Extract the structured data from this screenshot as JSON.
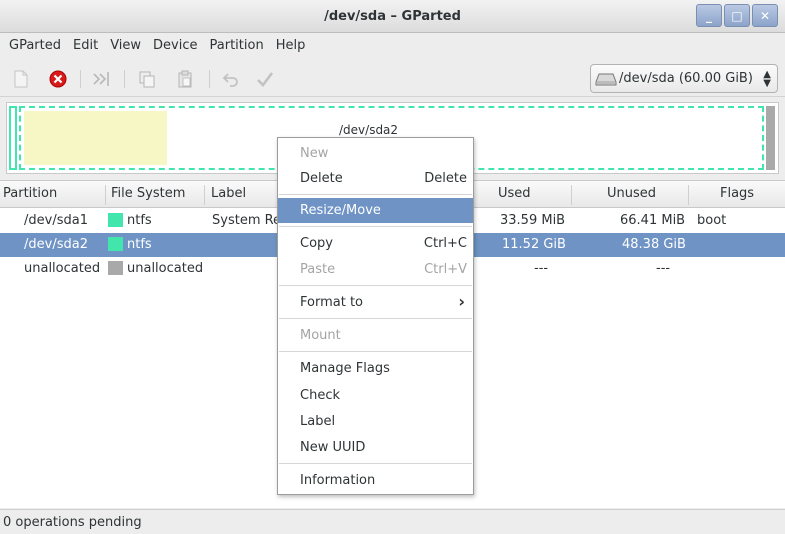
{
  "window": {
    "title": "/dev/sda – GParted",
    "controls": [
      "_",
      "□",
      "✕"
    ]
  },
  "menubar": [
    "GParted",
    "Edit",
    "View",
    "Device",
    "Partition",
    "Help"
  ],
  "toolbar": {
    "icons": [
      "new-icon",
      "delete-icon",
      "resize-move-icon",
      "copy-icon",
      "paste-icon",
      "undo-icon",
      "apply-icon"
    ],
    "device_selector": "/dev/sda  (60.00 GiB)"
  },
  "visual": {
    "selected_partition_label": "/dev/sda2"
  },
  "table": {
    "headers": [
      "Partition",
      "File System",
      "Label",
      "Used",
      "Unused",
      "Flags"
    ],
    "rows": [
      {
        "partition": "/dev/sda1",
        "filesystem": "ntfs",
        "label": "System Re",
        "used": "33.59 MiB",
        "unused": "66.41 MiB",
        "flags": "boot",
        "color": "#42e5ac"
      },
      {
        "partition": "/dev/sda2",
        "filesystem": "ntfs",
        "label": "",
        "used": "11.52 GiB",
        "unused": "48.38 GiB",
        "flags": "",
        "color": "#42e5ac"
      },
      {
        "partition": "unallocated",
        "filesystem": "unallocated",
        "label": "",
        "used": "---",
        "unused": "---",
        "flags": "",
        "color": "#a9a9a9"
      }
    ]
  },
  "context_menu": {
    "new": "New",
    "delete": "Delete",
    "delete_accel": "Delete",
    "resize_move": "Resize/Move",
    "copy": "Copy",
    "copy_accel": "Ctrl+C",
    "paste": "Paste",
    "paste_accel": "Ctrl+V",
    "format_to": "Format to",
    "mount": "Mount",
    "manage_flags": "Manage Flags",
    "check": "Check",
    "label": "Label",
    "new_uuid": "New UUID",
    "information": "Information"
  },
  "status": "0 operations pending",
  "colors": {
    "ntfs": "#42e5ac",
    "unallocated": "#a9a9a9",
    "selection": "#6e93c4"
  }
}
